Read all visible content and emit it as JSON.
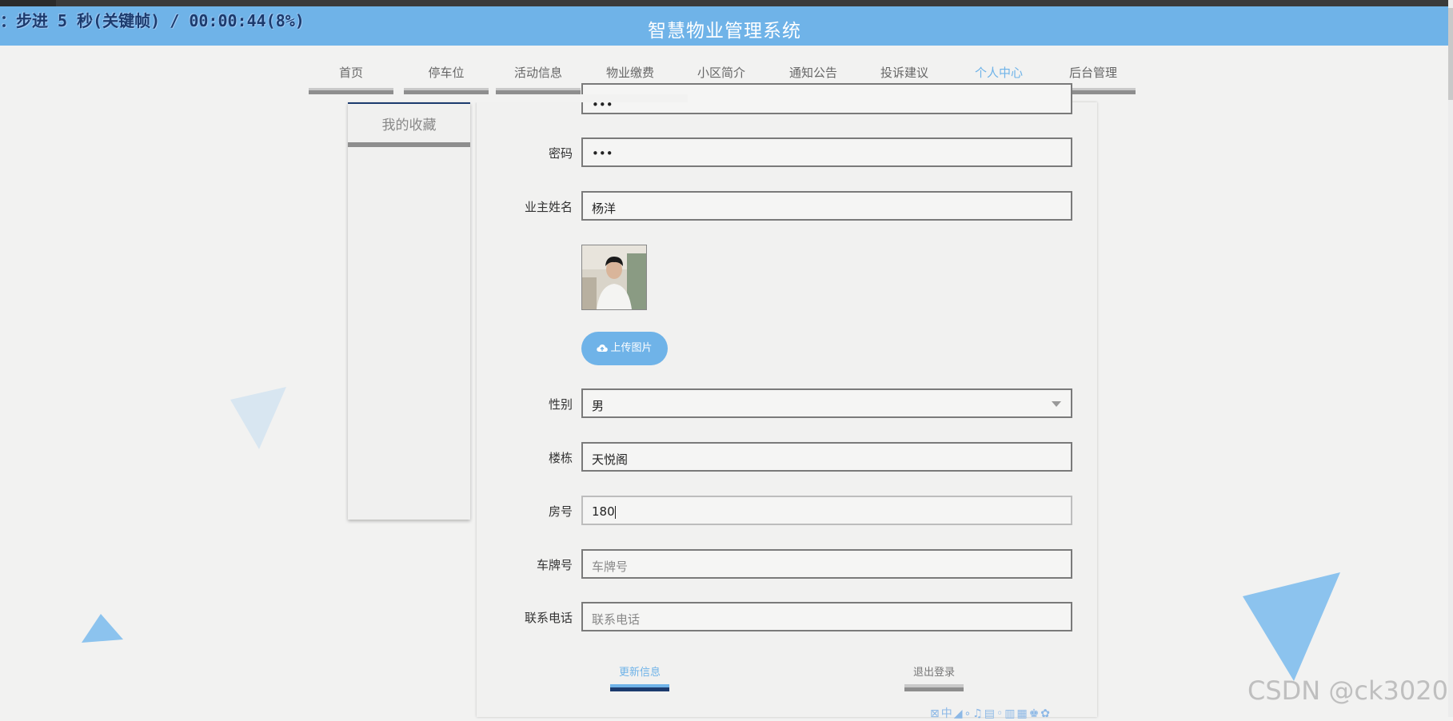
{
  "overlay": {
    "text": "：步进 5 秒(关键帧) / 00:00:44(8%)"
  },
  "header": {
    "title": "智慧物业管理系统"
  },
  "nav": {
    "items": [
      {
        "label": "首页",
        "active": false
      },
      {
        "label": "停车位",
        "active": false
      },
      {
        "label": "活动信息",
        "active": false
      },
      {
        "label": "物业缴费",
        "active": false
      },
      {
        "label": "小区简介",
        "active": false
      },
      {
        "label": "通知公告",
        "active": false
      },
      {
        "label": "投诉建议",
        "active": false
      },
      {
        "label": "个人中心",
        "active": true
      },
      {
        "label": "后台管理",
        "active": false
      }
    ]
  },
  "sidebar": {
    "items": [
      {
        "label": "我的收藏"
      }
    ]
  },
  "form": {
    "account": {
      "value": "•••"
    },
    "password": {
      "label": "密码",
      "value": "•••"
    },
    "owner_name": {
      "label": "业主姓名",
      "value": "杨洋"
    },
    "upload_button": "上传图片",
    "gender": {
      "label": "性别",
      "value": "男"
    },
    "building": {
      "label": "楼栋",
      "value": "天悦阁"
    },
    "room": {
      "label": "房号",
      "value": "180"
    },
    "plate": {
      "label": "车牌号",
      "placeholder": "车牌号"
    },
    "phone": {
      "label": "联系电话",
      "placeholder": "联系电话"
    }
  },
  "actions": {
    "update": "更新信息",
    "logout": "退出登录"
  },
  "watermark": "CSDN @ck3020",
  "ime_toolbar": "⊠中◢∘♫▤◦▥▦♚✿",
  "colors": {
    "accent": "#6fb3e8",
    "dark": "#1c3b6e",
    "background": "#f2f2f1",
    "bar_gray": "#8e8e8e"
  }
}
